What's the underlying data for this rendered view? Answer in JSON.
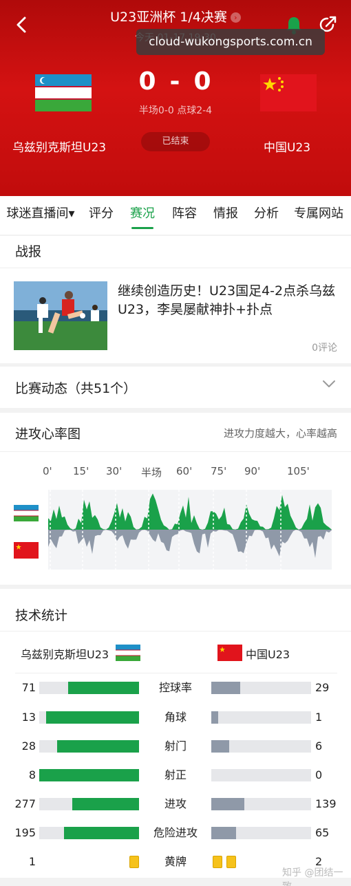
{
  "header": {
    "title": "U23亚洲杯 1/4决赛",
    "subtime": "今天 01-17 19:30",
    "watermark": "cloud-wukongsports.com.cn",
    "score_home": "0",
    "score_sep": "-",
    "score_away": "0",
    "half_info": "半场0-0 点球2-4",
    "home_team": "乌兹别克斯坦U23",
    "away_team": "中国U23",
    "status": "已结束"
  },
  "tabs": [
    {
      "label": "球迷直播间▾"
    },
    {
      "label": "评分"
    },
    {
      "label": "赛况"
    },
    {
      "label": "阵容"
    },
    {
      "label": "情报"
    },
    {
      "label": "分析"
    },
    {
      "label": "专属网站"
    }
  ],
  "report": {
    "title": "战报",
    "news_title": "继续创造历史！U23国足4-2点杀乌兹U23，李昊屡献神扑+扑点",
    "comments": "0评论"
  },
  "events": {
    "title": "比赛动态（共51个）"
  },
  "heart": {
    "title": "进攻心率图",
    "note": "进攻力度越大，心率越高",
    "ticks": [
      "0'",
      "15'",
      "30'",
      "半场",
      "60'",
      "75'",
      "90'",
      "105'"
    ]
  },
  "stats": {
    "title": "技术统计",
    "home_team": "乌兹别克斯坦U23",
    "away_team": "中国U23",
    "rows": [
      {
        "label": "控球率",
        "home": "71",
        "away": "29"
      },
      {
        "label": "角球",
        "home": "13",
        "away": "1"
      },
      {
        "label": "射门",
        "home": "28",
        "away": "6"
      },
      {
        "label": "射正",
        "home": "8",
        "away": "0"
      },
      {
        "label": "进攻",
        "home": "277",
        "away": "139"
      },
      {
        "label": "危险进攻",
        "home": "195",
        "away": "65"
      },
      {
        "label": "黄牌",
        "home": "1",
        "away": "2"
      }
    ]
  },
  "footer": {
    "credit": "知乎 @团结一致"
  },
  "colors": {
    "brand_red": "#d41212",
    "accent_green": "#1aa14a",
    "away_gray": "#8f99a8",
    "yellow_card": "#f6c21b"
  }
}
